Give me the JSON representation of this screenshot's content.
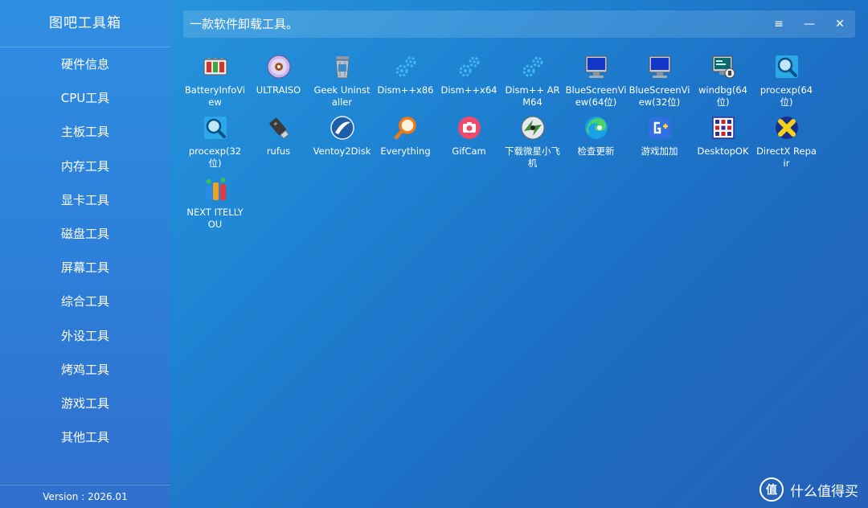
{
  "app": {
    "title": "图吧工具箱",
    "version": "Version : 2026.01"
  },
  "sidebar": {
    "items": [
      {
        "label": "硬件信息"
      },
      {
        "label": "CPU工具"
      },
      {
        "label": "主板工具"
      },
      {
        "label": "内存工具"
      },
      {
        "label": "显卡工具"
      },
      {
        "label": "磁盘工具"
      },
      {
        "label": "屏幕工具"
      },
      {
        "label": "综合工具"
      },
      {
        "label": "外设工具"
      },
      {
        "label": "烤鸡工具"
      },
      {
        "label": "游戏工具"
      },
      {
        "label": "其他工具"
      }
    ]
  },
  "titlebar": {
    "title": "一款软件卸载工具。",
    "menu_glyph": "≡",
    "min_glyph": "—",
    "close_glyph": "✕"
  },
  "apps": [
    {
      "label": "BatteryInfoView",
      "icon": "battery-icon"
    },
    {
      "label": "ULTRAISO",
      "icon": "disc-icon"
    },
    {
      "label": "Geek Uninstaller",
      "icon": "trash-can-icon"
    },
    {
      "label": "Dism++x86",
      "icon": "gears-icon"
    },
    {
      "label": "Dism++x64",
      "icon": "gears-icon"
    },
    {
      "label": "Dism++ ARM64",
      "icon": "gears-icon"
    },
    {
      "label": "BlueScreenView(64位)",
      "icon": "monitor-icon"
    },
    {
      "label": "BlueScreenView(32位)",
      "icon": "monitor-icon"
    },
    {
      "label": "windbg(64位)",
      "icon": "debug-monitor-icon"
    },
    {
      "label": "procexp(64位)",
      "icon": "magnifier-icon"
    },
    {
      "label": "procexp(32位)",
      "icon": "magnifier-icon"
    },
    {
      "label": "rufus",
      "icon": "usb-drive-icon"
    },
    {
      "label": "Ventoy2Disk",
      "icon": "ventoy-icon"
    },
    {
      "label": "Everything",
      "icon": "search-icon"
    },
    {
      "label": "GifCam",
      "icon": "camera-icon"
    },
    {
      "label": "下载微星小飞机",
      "icon": "afterburner-icon"
    },
    {
      "label": "检查更新",
      "icon": "edge-icon"
    },
    {
      "label": "游戏加加",
      "icon": "game-plus-icon"
    },
    {
      "label": "DesktopOK",
      "icon": "desktop-grid-icon"
    },
    {
      "label": "DirectX Repair",
      "icon": "directx-icon"
    },
    {
      "label": "NEXT ITELLYOU",
      "icon": "itellyou-icon"
    }
  ],
  "watermark": {
    "logo_text": "值",
    "text": "什么值得买"
  }
}
